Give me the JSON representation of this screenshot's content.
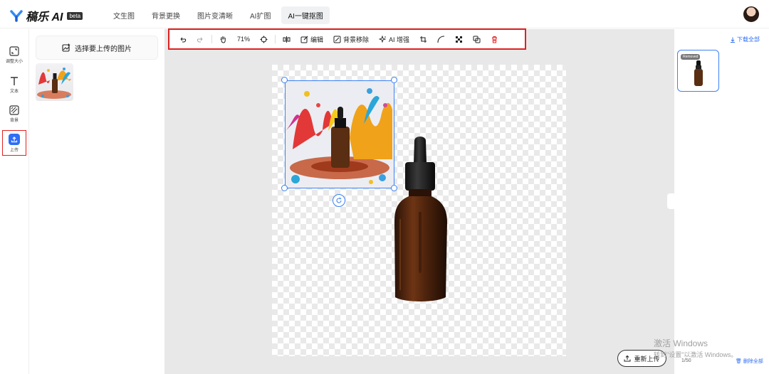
{
  "app": {
    "name": "稿乐 AI",
    "badge": "beta"
  },
  "nav": {
    "items": [
      "文生图",
      "背景更换",
      "图片变清晰",
      "AI扩图",
      "AI一键抠图"
    ]
  },
  "lefttools": {
    "items": [
      "调整大小",
      "文本",
      "背景",
      "上传"
    ]
  },
  "panel": {
    "select_label": "选择要上传的图片"
  },
  "toolbar": {
    "zoom": "71%",
    "edit": "编辑",
    "remove_bg": "背景移除",
    "enhance": "AI 增强"
  },
  "right": {
    "download_all": "下载全部",
    "removed_badge": "Removed",
    "reupload": "重新上传",
    "counter": "1/50",
    "delete_all": "删除全部"
  },
  "watermark": {
    "line1": "激活 Windows",
    "line2": "转到\"设置\"以激活 Windows。"
  },
  "colors": {
    "accent": "#2f6ef5",
    "highlight": "#e02020",
    "selection": "#3b82f6"
  }
}
